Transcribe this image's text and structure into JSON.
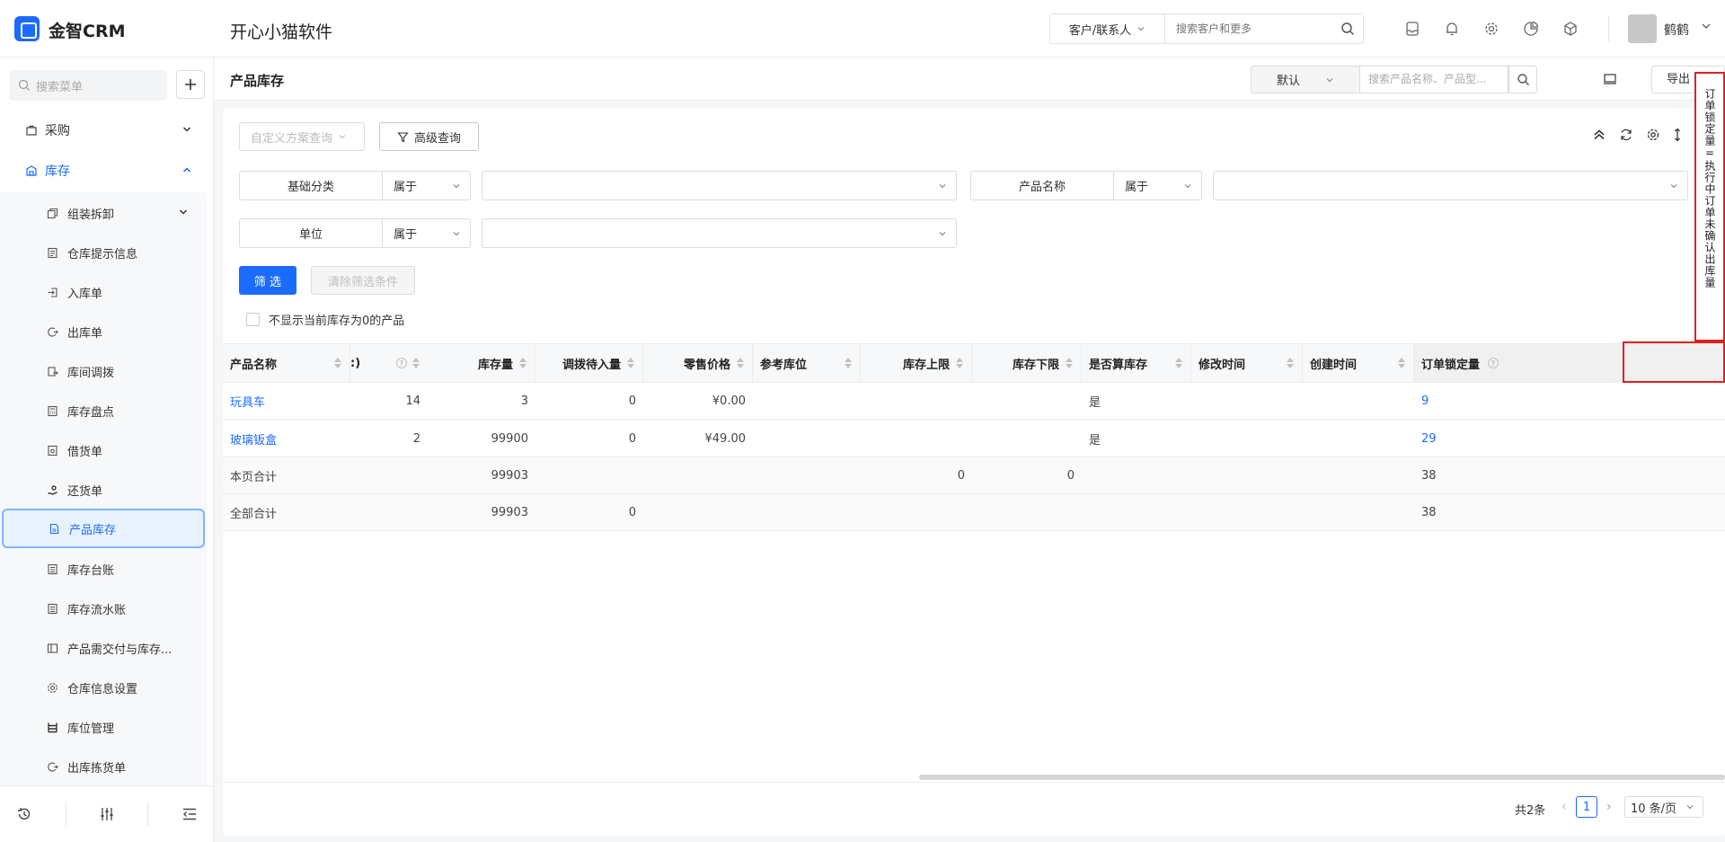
{
  "app": {
    "brand": "金智CRM",
    "company": "开心小猫软件",
    "accent": "#1b6bff"
  },
  "header": {
    "search_type": "客户/联系人",
    "search_placeholder": "搜索客户和更多",
    "icons": [
      "inbox-icon",
      "bell-icon",
      "settings-icon",
      "chart-icon",
      "box-icon"
    ],
    "user": "鹤鹤"
  },
  "sidebar": {
    "search_placeholder": "搜索菜单",
    "groups": [
      {
        "label": "采购"
      },
      {
        "label": "库存"
      }
    ],
    "items": [
      {
        "label": "组装拆卸"
      },
      {
        "label": "仓库提示信息"
      },
      {
        "label": "入库单"
      },
      {
        "label": "出库单"
      },
      {
        "label": "库间调拨"
      },
      {
        "label": "库存盘点"
      },
      {
        "label": "借货单"
      },
      {
        "label": "还货单"
      },
      {
        "label": "产品库存"
      },
      {
        "label": "库存台账"
      },
      {
        "label": "库存流水账"
      },
      {
        "label": "产品需交付与库存..."
      },
      {
        "label": "仓库信息设置"
      },
      {
        "label": "库位管理"
      },
      {
        "label": "出库拣货单"
      }
    ]
  },
  "page": {
    "title": "产品库存",
    "view": "默认",
    "search_placeholder": "搜索产品名称、产品型...",
    "export_label": "导出"
  },
  "filters": {
    "scheme_placeholder": "自定义方案查询",
    "advanced_label": "高级查询",
    "rows": [
      {
        "field": "基础分类",
        "op": "属于"
      },
      {
        "field": "产品名称",
        "op": "属于"
      },
      {
        "field": "单位",
        "op": "属于"
      }
    ],
    "submit_label": "筛 选",
    "clear_label": "清除筛选条件",
    "hide_zero_label": "不显示当前库存为0的产品"
  },
  "table": {
    "columns": [
      "产品名称",
      ":)",
      "库存量",
      "调拨待入量",
      "零售价格",
      "参考库位",
      "库存上限",
      "库存下限",
      "是否算库存",
      "修改时间",
      "创建时间",
      "订单锁定量"
    ],
    "rows": [
      {
        "name": "玩具车",
        "c1": "14",
        "stock": "3",
        "transfer": "0",
        "price": "¥0.00",
        "loc": "",
        "upper": "",
        "lower": "",
        "counts": "是",
        "modified": "",
        "created": "",
        "locked": "9"
      },
      {
        "name": "玻璃钣盒",
        "c1": "2",
        "stock": "99900",
        "transfer": "0",
        "price": "¥49.00",
        "loc": "",
        "upper": "",
        "lower": "",
        "counts": "是",
        "modified": "",
        "created": "",
        "locked": "29"
      }
    ],
    "page_sum": {
      "label": "本页合计",
      "stock": "99903",
      "upper": "0",
      "lower": "0",
      "locked": "38"
    },
    "all_sum": {
      "label": "全部合计",
      "stock": "99903",
      "transfer": "0",
      "locked": "38"
    }
  },
  "pagination": {
    "total": "共2条",
    "current": "1",
    "page_size": "10 条/页"
  },
  "tooltip": {
    "text": "订单锁定量=执行中订单未确认出库量"
  }
}
